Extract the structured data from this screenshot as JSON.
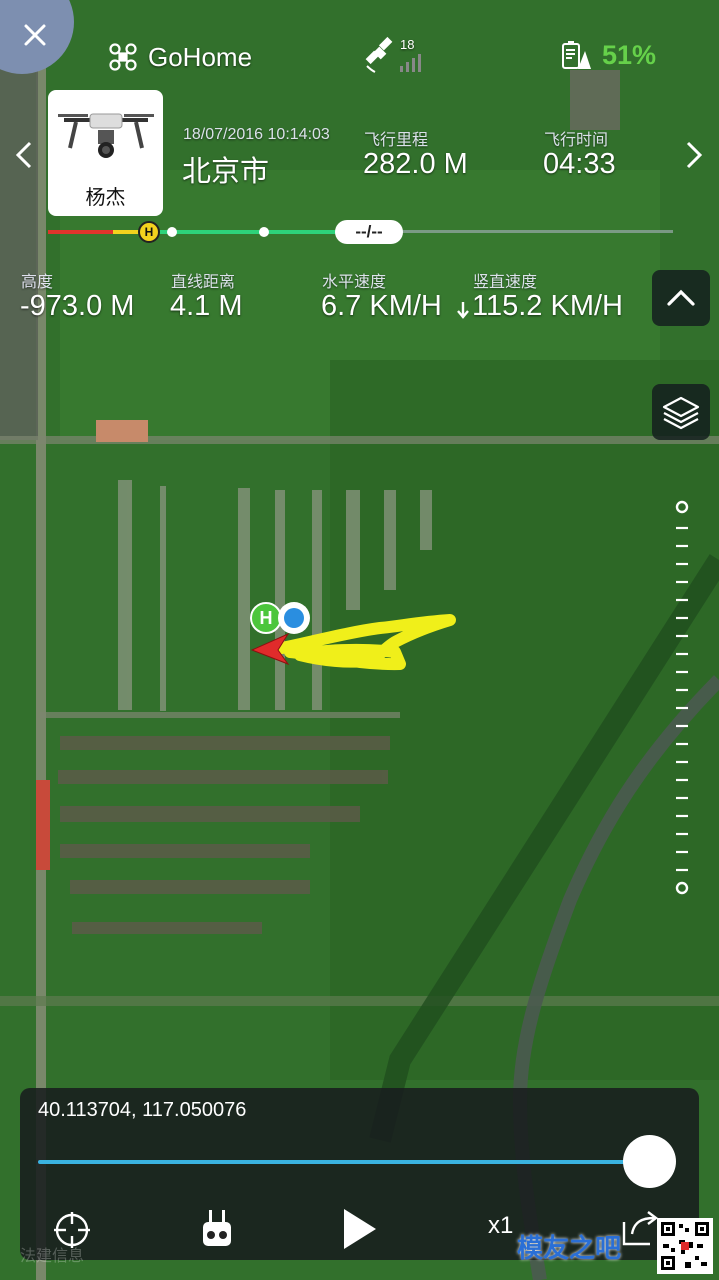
{
  "header": {
    "app_name": "GoHome",
    "satellite_count": "18",
    "battery_percent": "51%"
  },
  "flight": {
    "pilot_name": "杨杰",
    "datetime": "18/07/2016 10:14:03",
    "city": "北京市",
    "distance_label": "飞行里程",
    "distance_value": "282.0 M",
    "duration_label": "飞行时间",
    "duration_value": "04:33"
  },
  "timeline": {
    "home_marker": "H",
    "current_label": "--/--"
  },
  "telemetry": [
    {
      "label": "高度",
      "value": "-973.0 M"
    },
    {
      "label": "直线距离",
      "value": "4.1 M"
    },
    {
      "label": "水平速度",
      "value": "6.7 KM/H"
    },
    {
      "label": "竖直速度",
      "value": "115.2 KM/H"
    }
  ],
  "map": {
    "home_marker": "H"
  },
  "playback": {
    "coordinates": "40.113704, 117.050076",
    "progress": 0.95,
    "speed": "x1"
  },
  "overlay": {
    "faint_text": "法建信息",
    "watermark": "模友之吧"
  },
  "colors": {
    "accent": "#3ab3e0",
    "battery": "#66d14a",
    "flight_path": "#f0ef1a",
    "timeline_green": "#2ed37a"
  },
  "icons": {
    "close": "close-icon",
    "drone": "drone-icon",
    "satellite": "satellite-icon",
    "battery": "battery-icon",
    "prev": "chevron-left-icon",
    "next": "chevron-right-icon",
    "collapse": "chevron-up-icon",
    "layers": "layers-icon",
    "locate": "crosshair-icon",
    "controller": "remote-controller-icon",
    "play": "play-icon",
    "export": "export-icon"
  }
}
